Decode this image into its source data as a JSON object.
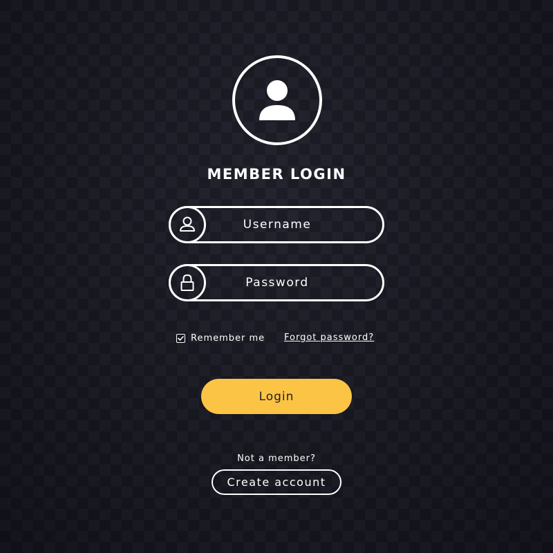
{
  "form": {
    "title": "MEMBER LOGIN",
    "avatar_icon": "user-icon",
    "username": {
      "placeholder": "Username",
      "value": "",
      "icon": "user-icon"
    },
    "password": {
      "placeholder": "Password",
      "value": "",
      "icon": "lock-icon"
    },
    "remember": {
      "label": "Remember me",
      "checked": true
    },
    "forgot_label": "Forgot password?",
    "login_label": "Login",
    "not_member_text": "Not a member?",
    "create_account_label": "Create account"
  },
  "colors": {
    "background": "#1a1b23",
    "checker": "#23242d",
    "foreground": "#ffffff",
    "accent": "#fcc444",
    "button_text": "#1e1f28"
  }
}
